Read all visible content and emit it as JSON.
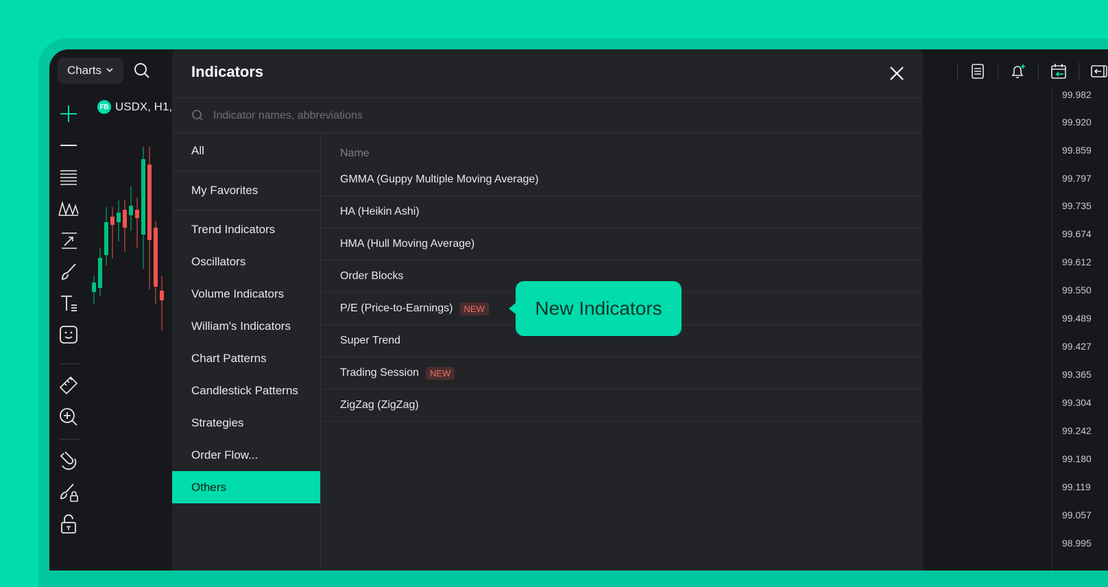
{
  "toolbar": {
    "charts_label": "Charts",
    "icons": [
      "chevron-down-icon",
      "search-icon",
      "layout-icon",
      "alert-bell-icon",
      "calendar-icon",
      "collapse-panel-icon"
    ]
  },
  "left_tools": [
    "crosshair-icon",
    "horizontal-line-icon",
    "fib-lines-icon",
    "pattern-icon",
    "trend-arrow-icon",
    "brush-icon",
    "text-icon",
    "emoji-icon",
    "ruler-icon",
    "zoom-in-icon",
    "magnet-icon",
    "lock-drawing-icon",
    "unlock-icon"
  ],
  "chart": {
    "symbol_badge": "FB",
    "symbol_label": "USDX, H1,",
    "price_labels": [
      "99.982",
      "99.920",
      "99.859",
      "99.797",
      "99.735",
      "99.674",
      "99.612",
      "99.550",
      "99.489",
      "99.427",
      "99.365",
      "99.304",
      "99.242",
      "99.180",
      "99.119",
      "99.057",
      "98.995"
    ]
  },
  "modal": {
    "title": "Indicators",
    "search_placeholder": "Indicator names, abbreviations",
    "categories": [
      {
        "label": "All"
      },
      {
        "label": "My Favorites"
      },
      {
        "label": "Trend Indicators"
      },
      {
        "label": "Oscillators"
      },
      {
        "label": "Volume Indicators"
      },
      {
        "label": "William's Indicators"
      },
      {
        "label": "Chart Patterns"
      },
      {
        "label": "Candlestick Patterns"
      },
      {
        "label": "Strategies"
      },
      {
        "label": "Order Flow..."
      },
      {
        "label": "Others",
        "active": true
      }
    ],
    "column_header": "Name",
    "indicators": [
      {
        "name": "GMMA (Guppy Multiple Moving Average)"
      },
      {
        "name": "HA (Heikin Ashi)"
      },
      {
        "name": "HMA (Hull Moving Average)"
      },
      {
        "name": "Order Blocks"
      },
      {
        "name": "P/E (Price-to-Earnings)",
        "badge": "NEW"
      },
      {
        "name": "Super Trend"
      },
      {
        "name": "Trading Session",
        "badge": "NEW"
      },
      {
        "name": "ZigZag (ZigZag)"
      }
    ]
  },
  "tooltip": {
    "text": "New Indicators"
  },
  "colors": {
    "accent": "#00dcac",
    "panel": "#232428",
    "app_bg": "#17181b",
    "new_badge_text": "#f06f6a",
    "candle_up": "#00c07f",
    "candle_down": "#f0544f"
  }
}
